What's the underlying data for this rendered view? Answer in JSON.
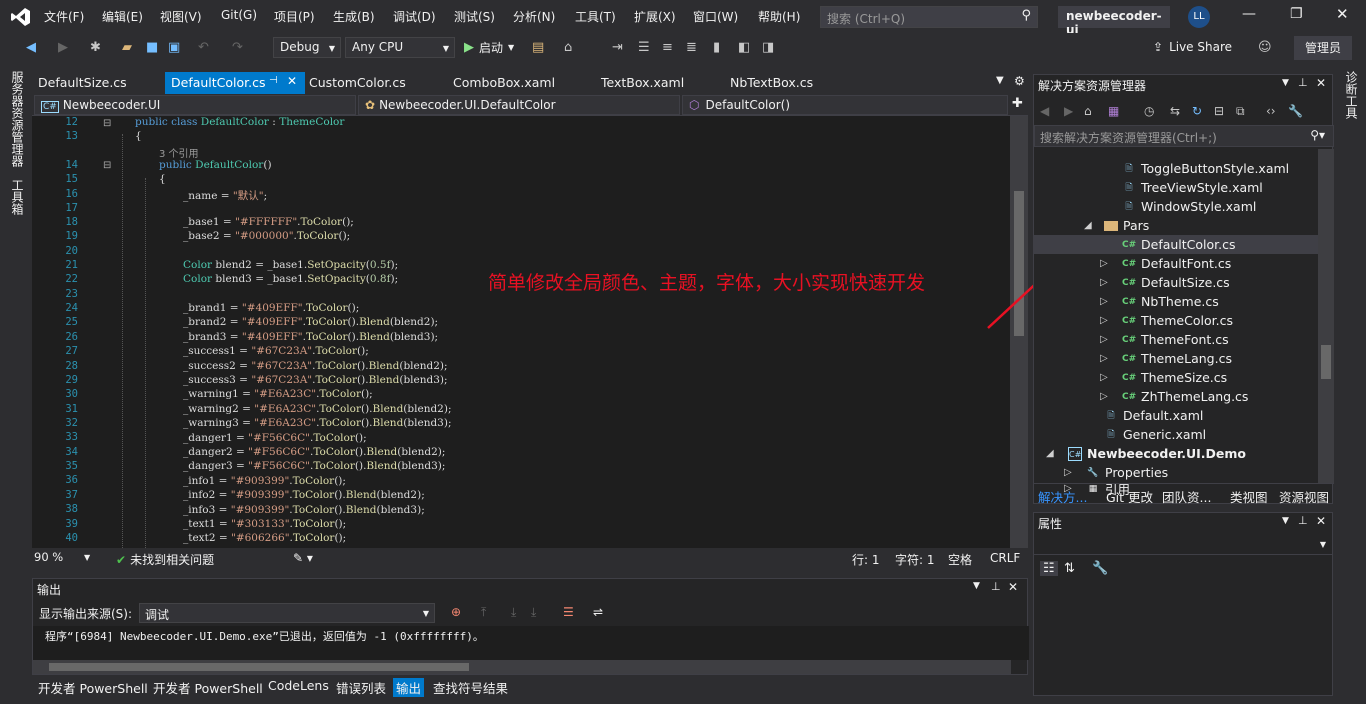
{
  "menu": [
    "文件(F)",
    "编辑(E)",
    "视图(V)",
    "Git(G)",
    "项目(P)",
    "生成(B)",
    "调试(D)",
    "测试(S)",
    "分析(N)",
    "工具(T)",
    "扩展(X)",
    "窗口(W)",
    "帮助(H)"
  ],
  "search": {
    "placeholder": "搜索 (Ctrl+Q)"
  },
  "project_name": "newbeecoder-ui",
  "user_initials": "LL",
  "toolbar": {
    "config": "Debug",
    "platform": "Any CPU",
    "start": "启动",
    "live_share": "Live Share",
    "admin": "管理员"
  },
  "left_strip": {
    "server_explorer": "服务器资源管理器",
    "toolbox": "工具箱"
  },
  "right_strip": {
    "diagnostics": "诊断工具"
  },
  "tabs": [
    "DefaultSize.cs",
    "DefaultColor.cs",
    "CustomColor.cs",
    "ComboBox.xaml",
    "TextBox.xaml",
    "NbTextBox.cs"
  ],
  "navbar": {
    "project": "Newbeecoder.UI",
    "class": "Newbeecoder.UI.DefaultColor",
    "member": "DefaultColor()"
  },
  "code": {
    "line_numbers": [
      "12",
      "13",
      "14",
      "15",
      "16",
      "17",
      "18",
      "19",
      "20",
      "21",
      "22",
      "23",
      "24",
      "25",
      "26",
      "27",
      "28",
      "29",
      "30",
      "31",
      "32",
      "33",
      "34",
      "35",
      "36",
      "37",
      "38",
      "39",
      "40"
    ],
    "l12_kw1": "public",
    "l12_kw2": "class",
    "l12_name": "DefaultColor",
    "l12_colon": " : ",
    "l12_base": "ThemeColor",
    "l13": "{",
    "refs": "3 个引用",
    "l14_kw": "public",
    "l14_name": "DefaultColor",
    "l14_rest": "()",
    "l15": "{",
    "l16_a": "_name = ",
    "l16_s": "\"默认\"",
    "l16_b": ";",
    "l18_a": "_base1 = ",
    "l18_s": "\"#FFFFFF\"",
    "l18_b": ".",
    "l18_m": "ToColor",
    "l18_c": "();",
    "l19_a": "_base2 = ",
    "l19_s": "\"#000000\"",
    "l19_b": ".",
    "l19_m": "ToColor",
    "l19_c": "();",
    "l21_t": "Color",
    "l21_a": " blend2 = _base1.",
    "l21_m": "SetOpacity",
    "l21_b": "(",
    "l21_n": "0.5f",
    "l21_c": ");",
    "l22_t": "Color",
    "l22_a": " blend3 = _base1.",
    "l22_m": "SetOpacity",
    "l22_b": "(",
    "l22_n": "0.8f",
    "l22_c": ");",
    "assign_lines": [
      {
        "v": "_brand1 = ",
        "s": "\"#409EFF\"",
        "tail": "",
        "arg": ""
      },
      {
        "v": "_brand2 = ",
        "s": "\"#409EFF\"",
        "tail": "Blend",
        "arg": "blend2"
      },
      {
        "v": "_brand3 = ",
        "s": "\"#409EFF\"",
        "tail": "Blend",
        "arg": "blend3"
      },
      {
        "v": "_success1 = ",
        "s": "\"#67C23A\"",
        "tail": "",
        "arg": ""
      },
      {
        "v": "_success2 = ",
        "s": "\"#67C23A\"",
        "tail": "Blend",
        "arg": "blend2"
      },
      {
        "v": "_success3 = ",
        "s": "\"#67C23A\"",
        "tail": "Blend",
        "arg": "blend3"
      },
      {
        "v": "_warning1 = ",
        "s": "\"#E6A23C\"",
        "tail": "",
        "arg": ""
      },
      {
        "v": "_warning2 = ",
        "s": "\"#E6A23C\"",
        "tail": "Blend",
        "arg": "blend2"
      },
      {
        "v": "_warning3 = ",
        "s": "\"#E6A23C\"",
        "tail": "Blend",
        "arg": "blend3"
      },
      {
        "v": "_danger1 = ",
        "s": "\"#F56C6C\"",
        "tail": "",
        "arg": ""
      },
      {
        "v": "_danger2 = ",
        "s": "\"#F56C6C\"",
        "tail": "Blend",
        "arg": "blend2"
      },
      {
        "v": "_danger3 = ",
        "s": "\"#F56C6C\"",
        "tail": "Blend",
        "arg": "blend3"
      },
      {
        "v": "_info1 = ",
        "s": "\"#909399\"",
        "tail": "",
        "arg": ""
      },
      {
        "v": "_info2 = ",
        "s": "\"#909399\"",
        "tail": "Blend",
        "arg": "blend2"
      },
      {
        "v": "_info3 = ",
        "s": "\"#909399\"",
        "tail": "Blend",
        "arg": "blend3"
      },
      {
        "v": "_text1 = ",
        "s": "\"#303133\"",
        "tail": "",
        "arg": ""
      },
      {
        "v": "_text2 = ",
        "s": "\"#606266\"",
        "tail": "",
        "arg": ""
      }
    ],
    "to_color": "ToColor"
  },
  "annotation": "简单修改全局颜色、主题，字体，大小实现快速开发",
  "editor_status": {
    "zoom": "90 %",
    "issues": "未找到相关问题",
    "line": "行: 1",
    "char": "字符: 1",
    "spaces": "空格",
    "eol": "CRLF"
  },
  "output": {
    "title": "输出",
    "source_label": "显示输出来源(S):",
    "source_value": "调试",
    "text": "程序“[6984] Newbeecoder.UI.Demo.exe”已退出，返回值为 -1 (0xffffffff)。"
  },
  "bottom_tabs": [
    "开发者 PowerShell",
    "开发者 PowerShell",
    "CodeLens",
    "错误列表",
    "输出",
    "查找符号结果"
  ],
  "solution": {
    "title": "解决方案资源管理器",
    "search_placeholder": "搜索解决方案资源管理器(Ctrl+;)",
    "items": [
      "ToggleButtonStyle.xaml",
      "TreeViewStyle.xaml",
      "WindowStyle.xaml",
      "Pars",
      "DefaultColor.cs",
      "DefaultFont.cs",
      "DefaultSize.cs",
      "NbTheme.cs",
      "ThemeColor.cs",
      "ThemeFont.cs",
      "ThemeLang.cs",
      "ThemeSize.cs",
      "ZhThemeLang.cs",
      "Default.xaml",
      "Generic.xaml",
      "Newbeecoder.UI.Demo",
      "Properties",
      "引用"
    ],
    "tabs": [
      "解决方...",
      "Git 更改",
      "团队资...",
      "类视图",
      "资源视图"
    ]
  },
  "properties": {
    "title": "属性"
  },
  "colors": {
    "accent": "#007acc",
    "annotation": "#e81123",
    "background": "#2d2d30",
    "editor_bg": "#1e1e1e"
  }
}
